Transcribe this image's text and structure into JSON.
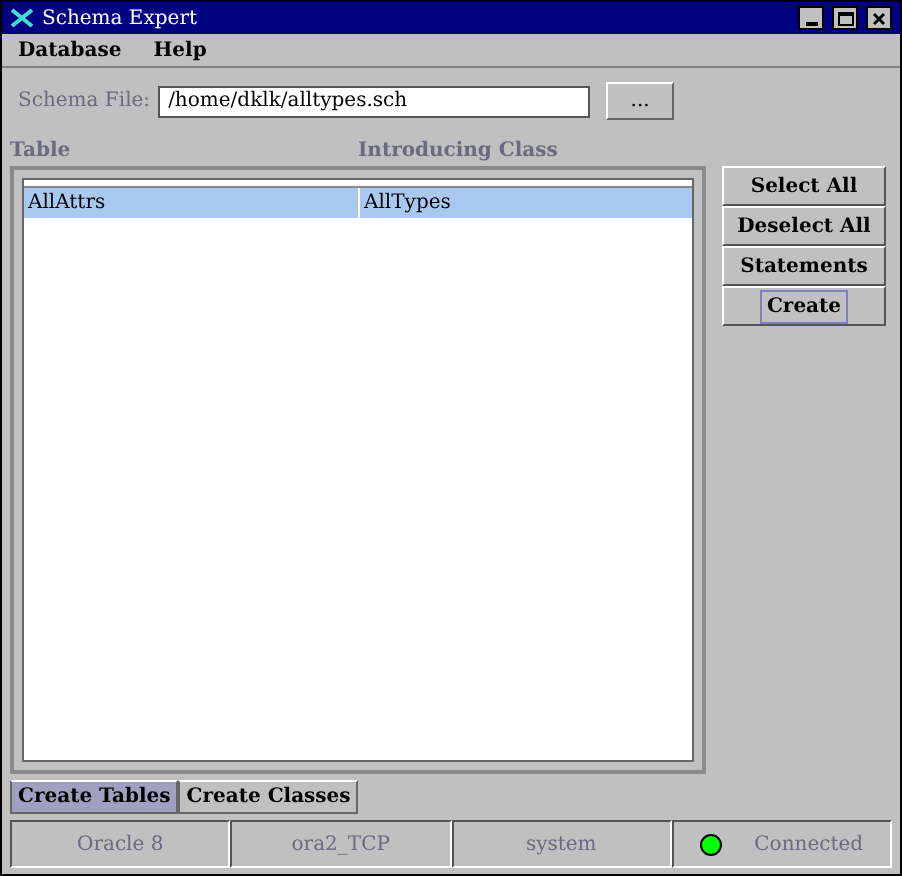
{
  "window": {
    "title": "Schema Expert"
  },
  "menu": [
    "Database",
    "Help"
  ],
  "schema_file": {
    "label": "Schema File:",
    "value": "/home/dklk/alltypes.sch",
    "browse": "..."
  },
  "table": {
    "columns": [
      "Table",
      "Introducing Class"
    ],
    "rows": [
      {
        "cells": [
          "AllAttrs",
          "AllTypes"
        ],
        "selected": true
      }
    ]
  },
  "buttons": [
    {
      "label": "Select All",
      "focused": false
    },
    {
      "label": "Deselect All",
      "focused": false
    },
    {
      "label": "Statements",
      "focused": false
    },
    {
      "label": "Create",
      "focused": true
    }
  ],
  "tabs": [
    {
      "label": "Create Tables",
      "selected": true
    },
    {
      "label": "Create Classes",
      "selected": false
    }
  ],
  "status_bar": [
    {
      "text": "Oracle 8"
    },
    {
      "text": "ora2_TCP"
    },
    {
      "text": "system"
    },
    {
      "text": "Connected",
      "connected": true
    }
  ]
}
